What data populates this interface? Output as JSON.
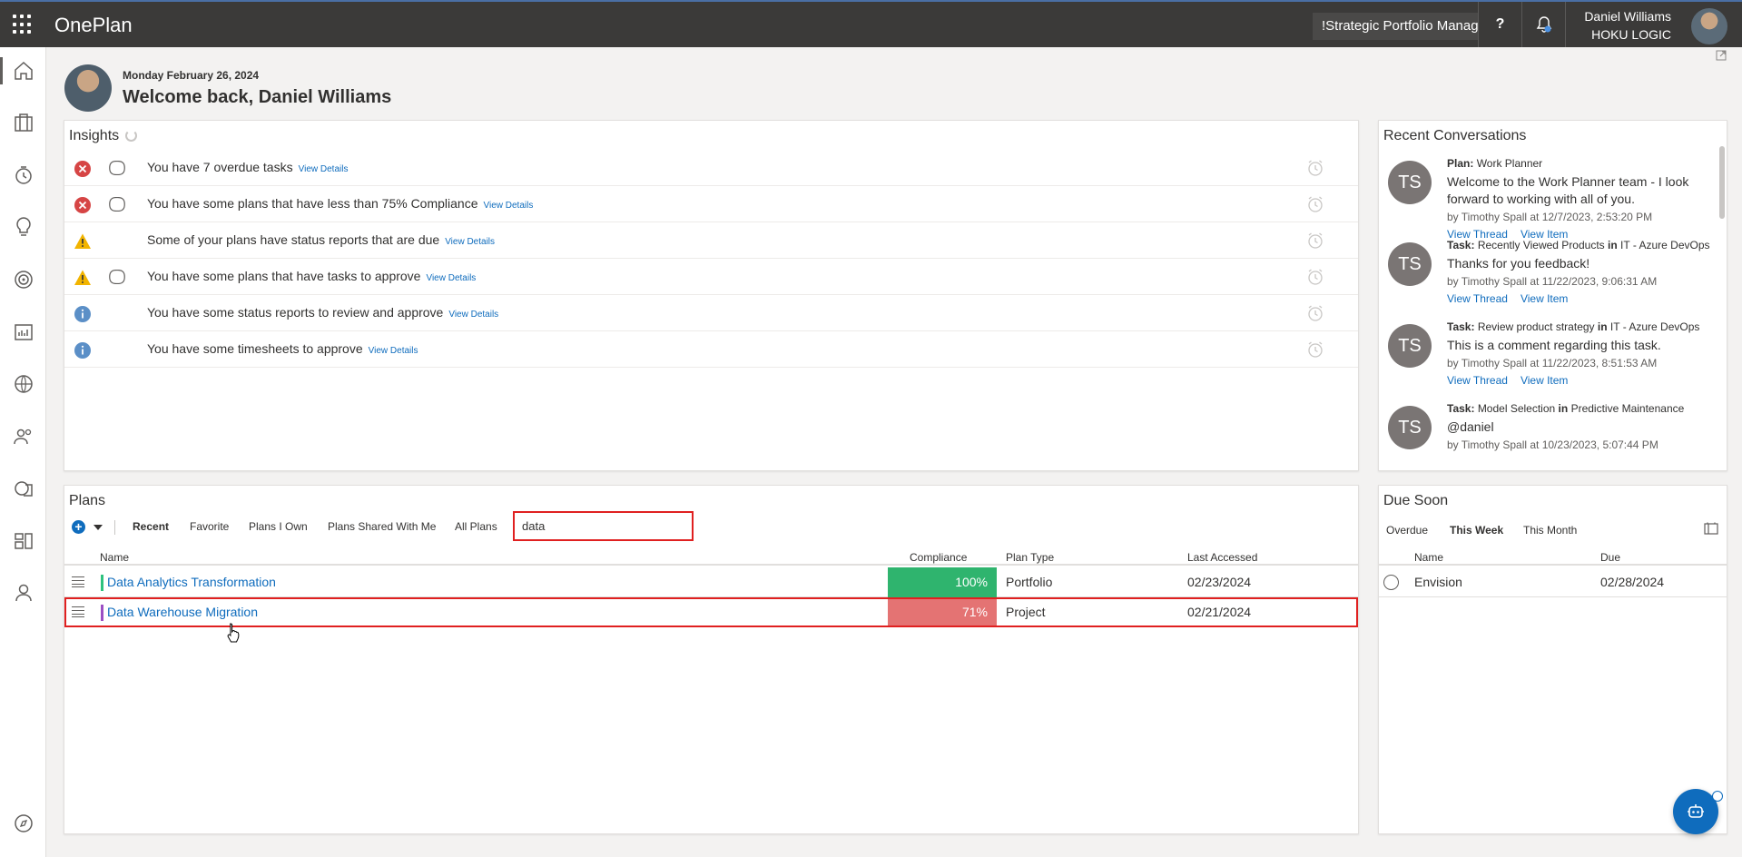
{
  "header": {
    "app_title": "OnePlan",
    "portfolio_selector": "!Strategic Portfolio Manager",
    "help_label": "?",
    "user_name": "Daniel Williams",
    "user_org": "HOKU LOGIC"
  },
  "welcome": {
    "date": "Monday February 26, 2024",
    "title": "Welcome back, Daniel Williams"
  },
  "insights": {
    "title": "Insights",
    "link_label": "View Details",
    "items": [
      {
        "severity": "error",
        "text": "You have 7 overdue tasks",
        "has_plan_icon": true
      },
      {
        "severity": "error",
        "text": "You have some plans that have less than 75% Compliance",
        "has_plan_icon": true
      },
      {
        "severity": "warning",
        "text": "Some of your plans have status reports that are due",
        "has_plan_icon": false
      },
      {
        "severity": "warning",
        "text": "You have some plans that have tasks to approve",
        "has_plan_icon": true
      },
      {
        "severity": "info",
        "text": "You have some status reports to review and approve",
        "has_plan_icon": false
      },
      {
        "severity": "info",
        "text": "You have some timesheets to approve",
        "has_plan_icon": false
      }
    ]
  },
  "conversations": {
    "title": "Recent Conversations",
    "view_thread": "View Thread",
    "view_item": "View Item",
    "items": [
      {
        "initials": "TS",
        "type": "Plan:",
        "subject": "Work Planner",
        "in_word": "",
        "context": "",
        "message": "Welcome to the Work Planner team - I look forward to working with all of you.",
        "by": "by Timothy Spall at 12/7/2023, 2:53:20 PM"
      },
      {
        "initials": "TS",
        "type": "Task:",
        "subject": "Recently Viewed Products",
        "in_word": "in",
        "context": "IT - Azure DevOps",
        "message": "Thanks for you feedback!",
        "by": "by Timothy Spall at 11/22/2023, 9:06:31 AM"
      },
      {
        "initials": "TS",
        "type": "Task:",
        "subject": "Review product strategy",
        "in_word": "in",
        "context": "IT - Azure DevOps",
        "message": "This is a comment regarding this task.",
        "by": "by Timothy Spall at 11/22/2023, 8:51:53 AM"
      },
      {
        "initials": "TS",
        "type": "Task:",
        "subject": "Model Selection",
        "in_word": "in",
        "context": "Predictive Maintenance",
        "message": "@daniel",
        "by": "by Timothy Spall at 10/23/2023, 5:07:44 PM"
      }
    ]
  },
  "plans": {
    "title": "Plans",
    "tabs": [
      "Recent",
      "Favorite",
      "Plans I Own",
      "Plans Shared With Me",
      "All Plans"
    ],
    "active_tab": "Recent",
    "search_value": "data",
    "columns": {
      "name": "Name",
      "compliance": "Compliance",
      "plan_type": "Plan Type",
      "last_accessed": "Last Accessed"
    },
    "rows": [
      {
        "name": "Data Analytics Transformation",
        "compliance": "100%",
        "plan_type": "Portfolio",
        "last_accessed": "02/23/2024",
        "bar_color": "#2ec27e",
        "compliance_color": "#2fb46e"
      },
      {
        "name": "Data Warehouse Migration",
        "compliance": "71%",
        "plan_type": "Project",
        "last_accessed": "02/21/2024",
        "bar_color": "#9b4fc4",
        "compliance_color": "#e47373"
      }
    ]
  },
  "due_soon": {
    "title": "Due Soon",
    "tabs": [
      "Overdue",
      "This Week",
      "This Month"
    ],
    "active_tab": "This Week",
    "columns": {
      "name": "Name",
      "due": "Due"
    },
    "rows": [
      {
        "name": "Envision",
        "due": "02/28/2024"
      }
    ]
  },
  "nav_icons": [
    "home-icon",
    "briefcase-icon",
    "timer-icon",
    "lightbulb-icon",
    "target-icon",
    "chart-icon",
    "globe-icon",
    "people-icon",
    "data-icon",
    "boards-icon",
    "person-icon",
    "compass-icon"
  ]
}
